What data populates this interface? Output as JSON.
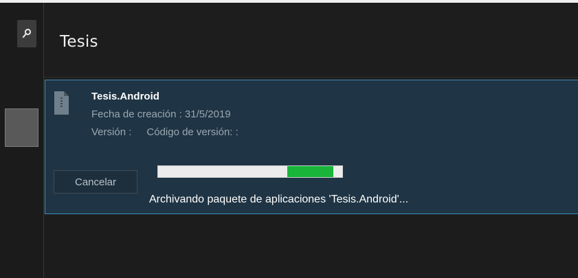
{
  "window": {
    "title": "Tesis"
  },
  "sidebar": {
    "search_icon": "search-icon"
  },
  "package": {
    "name": "Tesis.Android",
    "icon": "archive-file-icon",
    "creation_date_label": "Fecha de creación :",
    "creation_date": "31/5/2019",
    "version_label": "Versión :",
    "version_code_label": "Código de versión: :"
  },
  "actions": {
    "cancel_label": "Cancelar"
  },
  "progress": {
    "segment_start": 0.7,
    "segment_end": 0.95
  },
  "status": {
    "text": "Archivando paquete de aplicaciones 'Tesis.Android'..."
  },
  "colors": {
    "accent": "#3b8fb8",
    "progress": "#18b53a",
    "card_background": "#1f3444"
  }
}
